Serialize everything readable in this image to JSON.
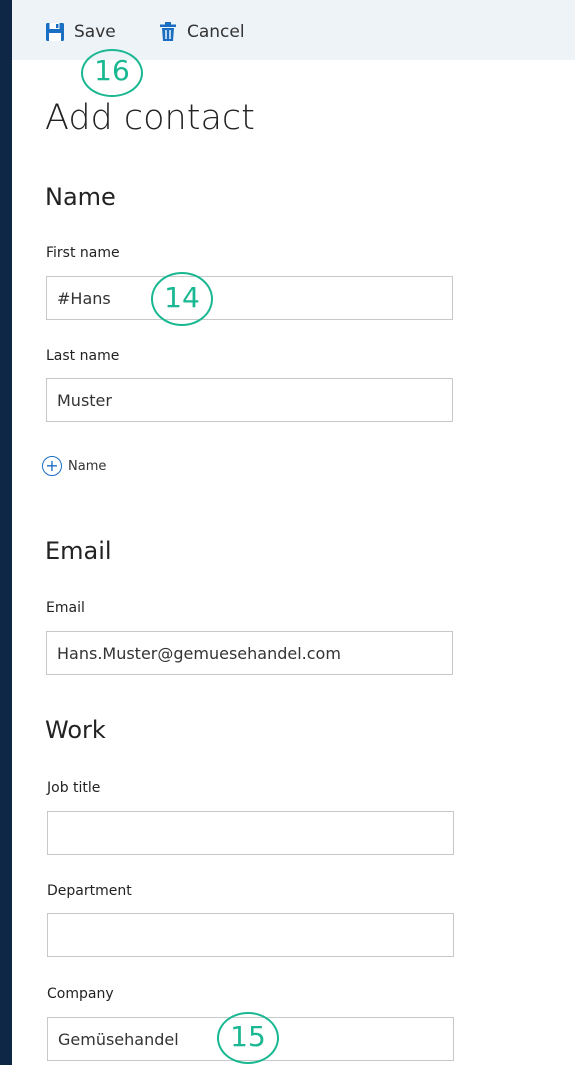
{
  "toolbar": {
    "save_label": "Save",
    "cancel_label": "Cancel",
    "save_icon": "floppy-disk-icon",
    "cancel_icon": "trash-icon",
    "accent_color": "#1a6fc2"
  },
  "page": {
    "title": "Add contact"
  },
  "sections": {
    "name": {
      "title": "Name",
      "first_name_label": "First name",
      "first_name_value": "#Hans",
      "last_name_label": "Last name",
      "last_name_value": "Muster",
      "add_name_label": "Name"
    },
    "email": {
      "title": "Email",
      "email_label": "Email",
      "email_value": "Hans.Muster@gemuesehandel.com"
    },
    "work": {
      "title": "Work",
      "job_title_label": "Job title",
      "job_title_value": "",
      "department_label": "Department",
      "department_value": "",
      "company_label": "Company",
      "company_value": "Gemüsehandel"
    }
  },
  "annotations": {
    "callout_save": "16",
    "callout_first_name": "14",
    "callout_company": "15",
    "color": "#19b892"
  }
}
